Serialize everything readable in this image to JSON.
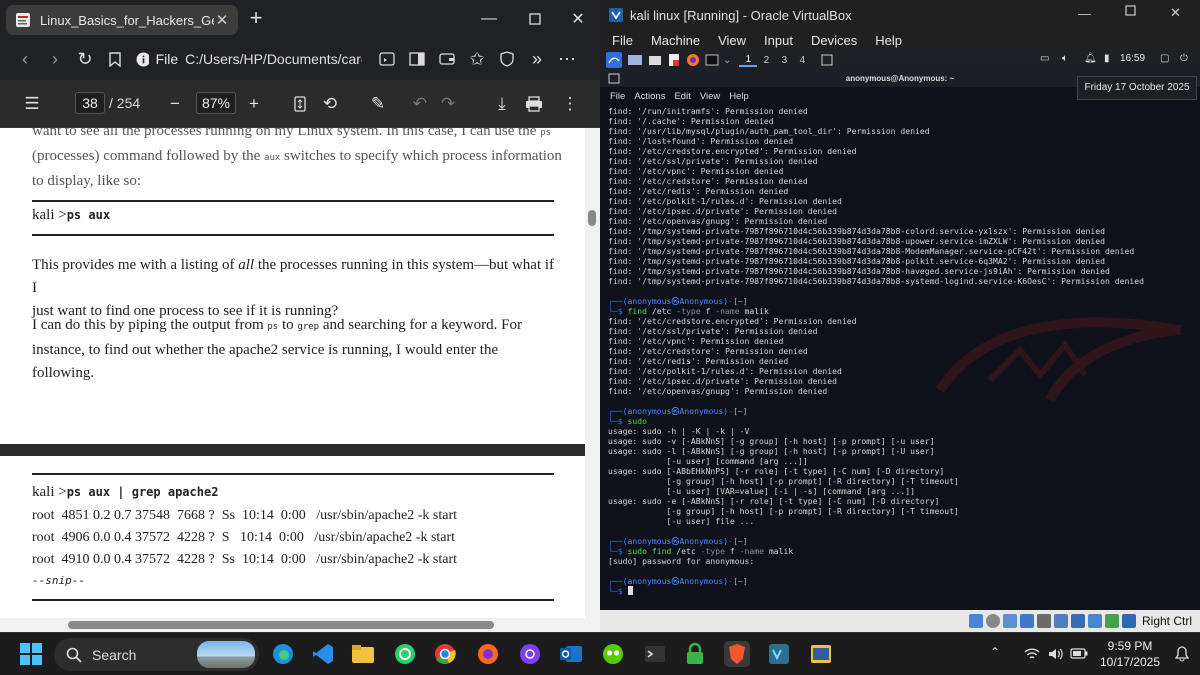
{
  "browser": {
    "tab_title": "Linux_Basics_for_Hackers_Getting",
    "address_label": "File",
    "address_path": "C:/Users/HP/Documents/career/Li",
    "page_current": "38",
    "page_total": "/ 254",
    "zoom": "87%"
  },
  "pdf": {
    "para0_line0": "want to see all the processes running on my Linux system. In this case, I can use the",
    "para0_code": "ps",
    "para0_line1a": "(processes) command followed by the",
    "para0_code2": "aux",
    "para0_line1b": "switches to specify which process information",
    "para0_line2": "to display, like so:",
    "cmd1_prompt": "kali >",
    "cmd1": "ps aux",
    "para1_a": "This provides me with a listing of",
    "para1_em": "all",
    "para1_b": "the processes running in this system—but what if I",
    "para1_line2": "just want to find one process to see if it is running?",
    "para2_a": "I can do this by piping the output from",
    "para2_code1": "ps",
    "para2_b": "to",
    "para2_code2": "grep",
    "para2_c": "and searching for a keyword. For",
    "para2_line2": "instance, to find out whether the apache2 service is running, I would enter the",
    "para2_line3": "following.",
    "cmd2_prompt": "kali >",
    "cmd2": "ps aux | grep apache2",
    "out": [
      "root  4851 0.2 0.7 37548  7668 ?  Ss  10:14  0:00   /usr/sbin/apache2 -k start",
      "root  4906 0.0 0.4 37572  4228 ?  S   10:14  0:00   /usr/sbin/apache2 -k start",
      "root  4910 0.0 0.4 37572  4228 ?  Ss  10:14  0:00   /usr/sbin/apache2 -k start"
    ],
    "snip": "--snip--"
  },
  "vbox": {
    "title": "kali linux [Running] - Oracle VirtualBox",
    "menu": [
      "File",
      "Machine",
      "View",
      "Input",
      "Devices",
      "Help"
    ],
    "workspaces": [
      "1",
      "2",
      "3",
      "4"
    ],
    "clock": "16:59",
    "date_tooltip": "Friday 17 October 2025",
    "term_title": "anonymous@Anonymous: ~",
    "term_menu": [
      "File",
      "Actions",
      "Edit",
      "View",
      "Help"
    ],
    "host_key": "Right Ctrl"
  },
  "terminal": {
    "lines1": [
      "find: '/run/initramfs': Permission denied",
      "find: '/.cache': Permission denied",
      "find: '/usr/lib/mysql/plugin/auth_pam_tool_dir': Permission denied",
      "find: '/lost+found': Permission denied",
      "find: '/etc/credstore.encrypted': Permission denied",
      "find: '/etc/ssl/private': Permission denied",
      "find: '/etc/vpnc': Permission denied",
      "find: '/etc/credstore': Permission denied",
      "find: '/etc/redis': Permission denied",
      "find: '/etc/polkit-1/rules.d': Permission denied",
      "find: '/etc/ipsec.d/private': Permission denied",
      "find: '/etc/openvas/gnupg': Permission denied",
      "find: '/tmp/systemd-private-7987f896710d4c56b339b874d3da78b8-colord.service-yxlszx': Permission denied",
      "find: '/tmp/systemd-private-7987f896710d4c56b339b874d3da78b8-upower.service-imZXLW': Permission denied",
      "find: '/tmp/systemd-private-7987f896710d4c56b339b874d3da78b8-ModemManager.service-pCF42t': Permission denied",
      "find: '/tmp/systemd-private-7987f896710d4c56b339b874d3da78b8-polkit.service-6q3MA2': Permission denied",
      "find: '/tmp/systemd-private-7987f896710d4c56b339b874d3da78b8-haveged.service-js9iAh': Permission denied",
      "find: '/tmp/systemd-private-7987f896710d4c56b339b874d3da78b8-systemd-logind.service-K6OesC': Permission denied"
    ],
    "prompt_user": "(anonymous㉿Anonymous)",
    "prompt_dir": "[~]",
    "cmd_a": "find",
    "cmd_a_args": " /etc ",
    "cmd_a_opts": "-type",
    "cmd_a_rest": " f ",
    "cmd_a_opt2": "-name",
    "cmd_a_val": " malik",
    "lines2": [
      "find: '/etc/credstore.encrypted': Permission denied",
      "find: '/etc/ssl/private': Permission denied",
      "find: '/etc/vpnc': Permission denied",
      "find: '/etc/credstore': Permission denied",
      "find: '/etc/redis': Permission denied",
      "find: '/etc/polkit-1/rules.d': Permission denied",
      "find: '/etc/ipsec.d/private': Permission denied",
      "find: '/etc/openvas/gnupg': Permission denied"
    ],
    "cmd_b": "sudo",
    "lines3": [
      "usage: sudo -h | -K | -k | -V",
      "usage: sudo -v [-ABkNnS] [-g group] [-h host] [-p prompt] [-u user]",
      "usage: sudo -l [-ABkNnS] [-g group] [-h host] [-p prompt] [-U user]",
      "            [-u user] [command [arg ...]]",
      "usage: sudo [-ABbEHkNnPS] [-r role] [-t type] [-C num] [-D directory]",
      "            [-g group] [-h host] [-p prompt] [-R directory] [-T timeout]",
      "            [-u user] [VAR=value] [-i | -s] [command [arg ...]]",
      "usage: sudo -e [-ABkNnS] [-r role] [-t type] [-C num] [-D directory]",
      "            [-g group] [-h host] [-p prompt] [-R directory] [-T timeout]",
      "            [-u user] file ..."
    ],
    "cmd_c1": "sudo",
    "cmd_c2": " find",
    "cmd_c_args": " /etc ",
    "cmd_c_opt": "-type",
    "cmd_c_rest": " f ",
    "cmd_c_opt2": "-name",
    "cmd_c_val": " malik",
    "line4": "[sudo] password for anonymous:"
  },
  "taskbar": {
    "search": "Search",
    "time": "9:59 PM",
    "date": "10/17/2025"
  },
  "colors": {
    "kali_blue": "#2f6fe0",
    "cmd_green": "#57d35a",
    "terminal_bg": "#0f111a"
  }
}
